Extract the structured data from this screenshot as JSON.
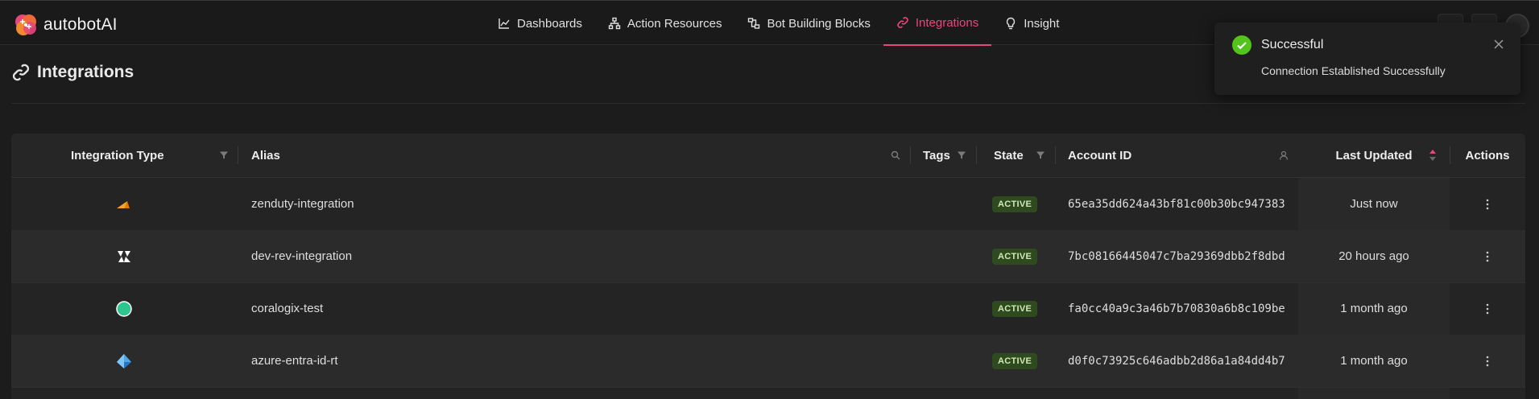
{
  "app": {
    "name": "autobotAI"
  },
  "nav": {
    "items": [
      {
        "label": "Dashboards",
        "icon": "chart-line-icon"
      },
      {
        "label": "Action Resources",
        "icon": "sitemap-icon"
      },
      {
        "label": "Bot Building Blocks",
        "icon": "blocks-icon"
      },
      {
        "label": "Integrations",
        "icon": "link-icon",
        "active": true
      },
      {
        "label": "Insight",
        "icon": "lightbulb-icon"
      }
    ]
  },
  "page": {
    "title": "Integrations"
  },
  "table": {
    "columns": {
      "integration_type": "Integration Type",
      "alias": "Alias",
      "tags": "Tags",
      "state": "State",
      "account_id": "Account ID",
      "last_updated": "Last Updated",
      "actions": "Actions"
    },
    "rows": [
      {
        "icon": "zenduty-icon",
        "alias": "zenduty-integration",
        "state": "ACTIVE",
        "account_id": "65ea35dd624a43bf81c00b30bc947383",
        "last_updated": "Just now"
      },
      {
        "icon": "devrev-icon",
        "alias": "dev-rev-integration",
        "state": "ACTIVE",
        "account_id": "7bc08166445047c7ba29369dbb2f8dbd",
        "last_updated": "20 hours ago"
      },
      {
        "icon": "coralogix-icon",
        "alias": "coralogix-test",
        "state": "ACTIVE",
        "account_id": "fa0cc40a9c3a46b7b70830a6b8c109be",
        "last_updated": "1 month ago"
      },
      {
        "icon": "azure-entra-icon",
        "alias": "azure-entra-id-rt",
        "state": "ACTIVE",
        "account_id": "d0f0c73925c646adbb2d86a1a84dd4b7",
        "last_updated": "1 month ago"
      }
    ]
  },
  "toast": {
    "title": "Successful",
    "message": "Connection Established Successfully"
  },
  "colors": {
    "accent": "#e8467c",
    "success": "#52c41a",
    "badge_bg": "#2f4a1f",
    "background": "#1c1c1c"
  }
}
